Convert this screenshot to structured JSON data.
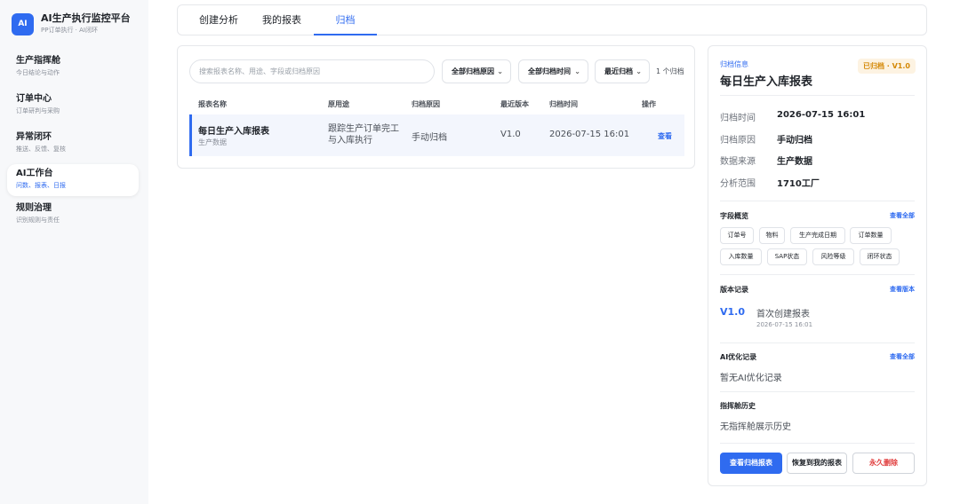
{
  "brand": {
    "logo": "AI",
    "title": "AI生产执行监控平台",
    "subtitle": "PP订单执行 · AI闭环"
  },
  "sidebar": {
    "items": [
      {
        "label": "生产指挥舱",
        "sub": "今日结论与动作"
      },
      {
        "label": "订单中心",
        "sub": "订单研判与采购"
      },
      {
        "label": "异常闭环",
        "sub": "推送、反馈、复核"
      },
      {
        "label": "AI工作台",
        "sub": "问数、报表、日报"
      },
      {
        "label": "规则治理",
        "sub": "识别规则与责任"
      }
    ],
    "active_index": 3
  },
  "tabs": [
    {
      "label": "创建分析"
    },
    {
      "label": "我的报表"
    },
    {
      "label": "归档"
    }
  ],
  "active_tab": 2,
  "list": {
    "search_placeholder": "搜索报表名称、用途、字段或归档原因",
    "filter_reason": "全部归档原因",
    "filter_time": "全部归档时间",
    "sort": "最近归档",
    "count": "1 个归档",
    "headers": [
      "报表名称",
      "原用途",
      "归档原因",
      "最近版本",
      "归档时间",
      "操作"
    ],
    "rows": [
      {
        "name": "每日生产入库报表",
        "source": "生产数据",
        "purpose": "跟踪生产订单完工与入库执行",
        "reason": "手动归档",
        "version": "V1.0",
        "time": "2026-07-15 16:01",
        "action": "查看"
      }
    ]
  },
  "detail": {
    "label": "归档信息",
    "title": "每日生产入库报表",
    "badge": "已归档 · V1.0",
    "fields": [
      {
        "k": "归档时间",
        "v": "2026-07-15 16:01"
      },
      {
        "k": "归档原因",
        "v": "手动归档"
      },
      {
        "k": "数据来源",
        "v": "生产数据"
      },
      {
        "k": "分析范围",
        "v": "1710工厂"
      }
    ],
    "field_overview": {
      "title": "字段概览",
      "link": "查看全部",
      "chips": [
        "订单号",
        "物料",
        "生产完成日期",
        "订单数量",
        "入库数量",
        "SAP状态",
        "风险等级",
        "闭环状态"
      ]
    },
    "versions": {
      "title": "版本记录",
      "link": "查看版本",
      "version": "V1.0",
      "desc": "首次创建报表",
      "time": "2026-07-15 16:01"
    },
    "ai_records": {
      "title": "AI优化记录",
      "link": "查看全部",
      "empty": "暂无AI优化记录"
    },
    "cockpit_history": {
      "title": "指挥舱历史",
      "empty": "无指挥舱展示历史"
    },
    "buttons": {
      "view": "查看归档报表",
      "restore": "恢复到我的报表",
      "delete": "永久删除"
    }
  },
  "colors": {
    "accent": "#2f6bf0",
    "danger": "#e03c3c",
    "badge": "#d48806"
  }
}
